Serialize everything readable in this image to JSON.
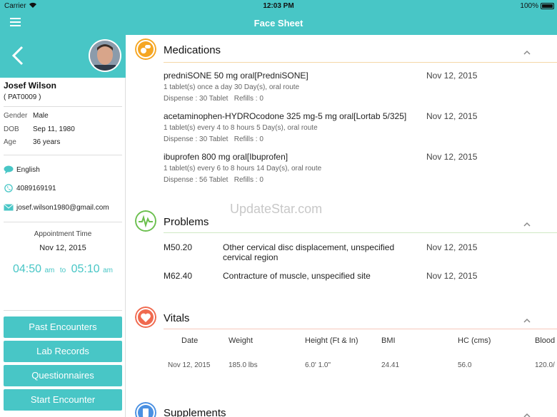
{
  "status_bar": {
    "carrier": "Carrier",
    "time": "12:03 PM",
    "battery": "100%"
  },
  "nav": {
    "title": "Face Sheet"
  },
  "patient": {
    "name": "Josef Wilson",
    "id": "( PAT0009 )",
    "gender_label": "Gender",
    "gender": "Male",
    "dob_label": "DOB",
    "dob": "Sep 11, 1980",
    "age_label": "Age",
    "age": "36 years",
    "language": "English",
    "phone": "4089169191",
    "email": "josef.wilson1980@gmail.com"
  },
  "appointment": {
    "label": "Appointment Time",
    "date": "Nov 12, 2015",
    "start": "04:50",
    "start_ampm": "am",
    "to": "to",
    "end": "05:10",
    "end_ampm": "am"
  },
  "sidebar_buttons": [
    "Past Encounters",
    "Lab Records",
    "Questionnaires",
    "Start Encounter"
  ],
  "watermark": "UpdateStar.com",
  "medications": {
    "title": "Medications",
    "items": [
      {
        "name": "predniSONE 50 mg oral[PredniSONE]",
        "date": "Nov 12, 2015",
        "sig": "1 tablet(s) once a day 30 Day(s), oral route",
        "dispense": "Dispense : 30 Tablet   Refills : 0"
      },
      {
        "name": "acetaminophen-HYDROcodone 325 mg-5 mg oral[Lortab 5/325]",
        "date": "Nov 12, 2015",
        "sig": "1 tablet(s) every 4 to 8 hours 5 Day(s), oral route",
        "dispense": "Dispense : 30 Tablet   Refills : 0"
      },
      {
        "name": "ibuprofen 800 mg oral[Ibuprofen]",
        "date": "Nov 12, 2015",
        "sig": "1 tablet(s) every 6 to 8 hours 14 Day(s), oral route",
        "dispense": "Dispense : 56 Tablet   Refills : 0"
      }
    ]
  },
  "problems": {
    "title": "Problems",
    "items": [
      {
        "code": "M50.20",
        "desc": "Other cervical disc displacement, unspecified cervical region",
        "date": "Nov 12, 2015"
      },
      {
        "code": "M62.40",
        "desc": "Contracture of muscle, unspecified site",
        "date": "Nov 12, 2015"
      }
    ]
  },
  "vitals": {
    "title": "Vitals",
    "headers": [
      "Date",
      "Weight",
      "Height (Ft & In)",
      "BMI",
      "HC (cms)",
      "Blood"
    ],
    "row": [
      "Nov 12, 2015",
      "185.0 lbs",
      "6.0' 1.0\"",
      "24.41",
      "56.0",
      "120.0/"
    ]
  },
  "supplements": {
    "title": "Supplements"
  },
  "colors": {
    "accent": "#48c6c6",
    "med_icon": "#f5a623",
    "prob_icon": "#6bbf4e",
    "vitals_icon": "#f06a4f",
    "supp_icon": "#4a90e2"
  }
}
